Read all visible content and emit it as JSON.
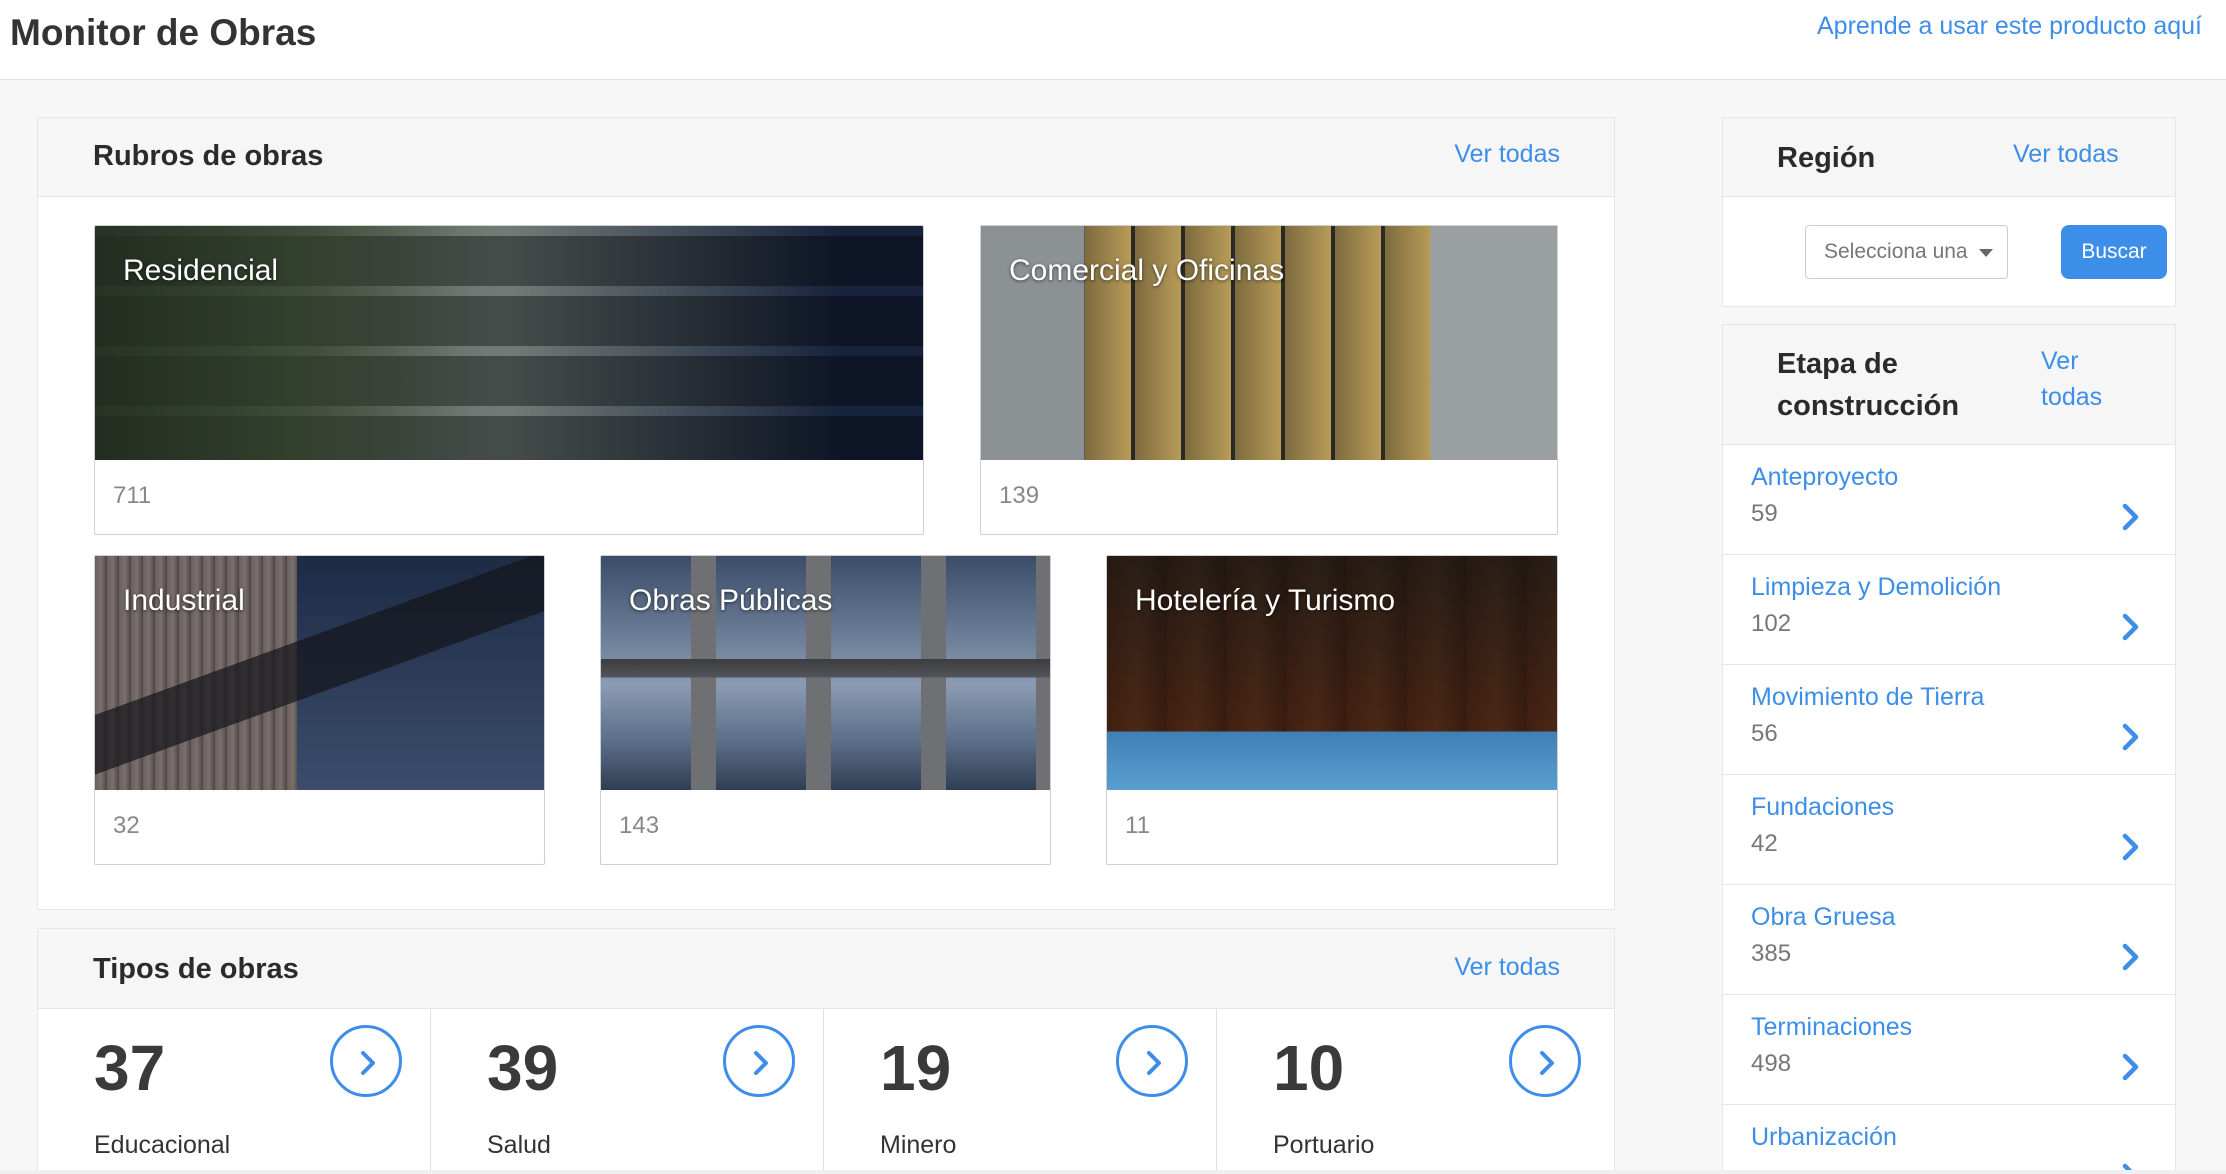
{
  "header": {
    "title": "Monitor de Obras",
    "help_link": "Aprende a usar este producto aquí"
  },
  "rubros": {
    "title": "Rubros de obras",
    "view_all": "Ver todas",
    "cards": [
      {
        "label": "Residencial",
        "count": "711",
        "photo": "residential-building-photo"
      },
      {
        "label": "Comercial y Oficinas",
        "count": "139",
        "photo": "commercial-building-photo"
      },
      {
        "label": "Industrial",
        "count": "32",
        "photo": "industrial-building-photo"
      },
      {
        "label": "Obras Públicas",
        "count": "143",
        "photo": "bridge-photo"
      },
      {
        "label": "Hotelería y Turismo",
        "count": "11",
        "photo": "hotel-pool-photo"
      }
    ]
  },
  "tipos": {
    "title": "Tipos de obras",
    "view_all": "Ver todas",
    "items": [
      {
        "count": "37",
        "name": "Educacional"
      },
      {
        "count": "39",
        "name": "Salud"
      },
      {
        "count": "19",
        "name": "Minero"
      },
      {
        "count": "10",
        "name": "Portuario"
      }
    ]
  },
  "region": {
    "title": "Región",
    "view_all": "Ver todas",
    "select_placeholder": "Selecciona una",
    "search_button": "Buscar"
  },
  "etapa": {
    "title": "Etapa de construcción",
    "view_all": "Ver todas",
    "items": [
      {
        "name": "Anteproyecto",
        "count": "59"
      },
      {
        "name": "Limpieza y Demolición",
        "count": "102"
      },
      {
        "name": "Movimiento de Tierra",
        "count": "56"
      },
      {
        "name": "Fundaciones",
        "count": "42"
      },
      {
        "name": "Obra Gruesa",
        "count": "385"
      },
      {
        "name": "Terminaciones",
        "count": "498"
      },
      {
        "name": "Urbanización",
        "count": ""
      }
    ]
  },
  "colors": {
    "accent": "#3d8ee8",
    "heading": "#2b2b2b",
    "panel_header_bg": "#f6f6f6"
  }
}
